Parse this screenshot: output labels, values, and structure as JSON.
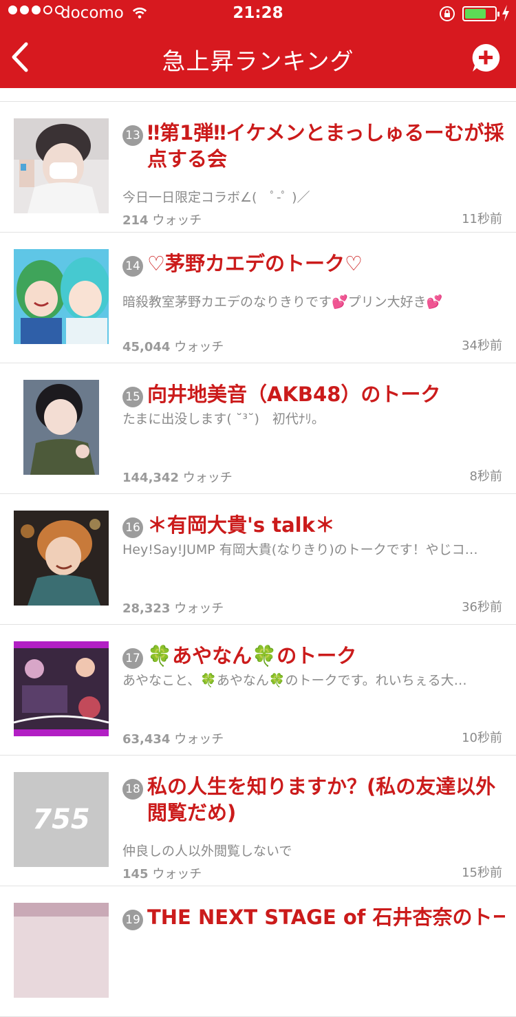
{
  "status_bar": {
    "carrier": "docomo",
    "time": "21:28",
    "battery_level": 0.6
  },
  "nav": {
    "title": "急上昇ランキング",
    "back_icon": "chevron-left-icon",
    "add_icon": "add-talk-icon"
  },
  "watch_suffix": "ウォッチ",
  "items": [
    {
      "rank": "13",
      "title": "‼第1弾‼イケメンとまっしゅるーむが採点する会",
      "desc": "今日一日限定コラボ∠(　ﾟ-ﾟ )／",
      "watch": "214",
      "time": "11秒前"
    },
    {
      "rank": "14",
      "title": "♡茅野カエデのトーク♡",
      "desc": "暗殺教室茅野カエデのなりきりです💕プリン大好き💕",
      "watch": "45,044",
      "time": "34秒前"
    },
    {
      "rank": "15",
      "title": "向井地美音（AKB48）のトーク",
      "desc": "たまに出没します( ˘³˘)　初代ﾅﾘ。",
      "watch": "144,342",
      "time": "8秒前"
    },
    {
      "rank": "16",
      "title": "＊有岡大貴's  talk＊",
      "desc": "Hey!Say!JUMP  有岡大貴(なりきり)のトークです！やじコ…",
      "watch": "28,323",
      "time": "36秒前"
    },
    {
      "rank": "17",
      "title": "🍀あやなん🍀のトーク",
      "desc": "あやなこと、🍀あやなん🍀のトークです。れいちぇる大…",
      "watch": "63,434",
      "time": "10秒前"
    },
    {
      "rank": "18",
      "title": "私の人生を知りますか？(私の友達以外閲覧だめ)",
      "desc": "仲良しの人以外閲覧しないで",
      "watch": "145",
      "time": "15秒前",
      "placeholder_logo": "755"
    },
    {
      "rank": "19",
      "title": "THE NEXT STAGE of 石井杏奈のトー"
    }
  ]
}
